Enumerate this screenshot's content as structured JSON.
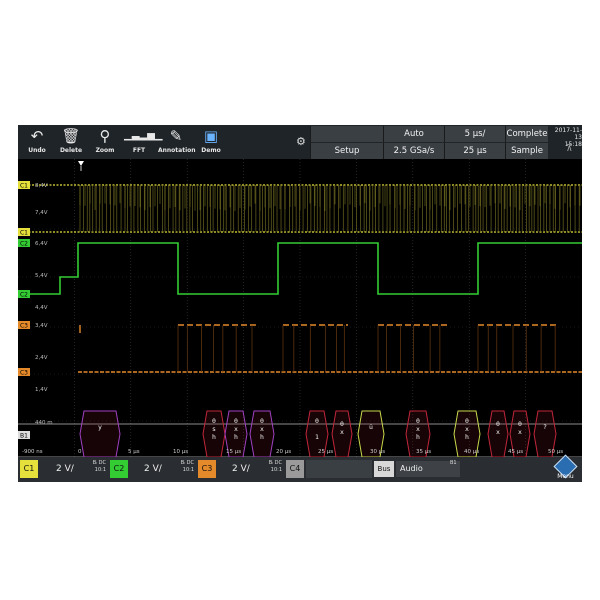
{
  "toolbar": {
    "buttons": [
      {
        "label": "Undo",
        "icon": "undo-arrow-icon"
      },
      {
        "label": "Delete",
        "icon": "trash-icon"
      },
      {
        "label": "Zoom",
        "icon": "magnifier-icon"
      },
      {
        "label": "FFT",
        "icon": "spectrum-icon"
      },
      {
        "label": "Annotation",
        "icon": "pencil-icon"
      },
      {
        "label": "Demo",
        "icon": "demo-monitor-icon"
      }
    ]
  },
  "header": {
    "trigger_source": "B1",
    "trigger_mode": "Auto",
    "time_scale": "5 µs/",
    "acq_state": "Complete",
    "setup": "Setup",
    "sample_rate": "2.5 GSa/s",
    "record_length": "25 µs",
    "acq_mode": "Sample",
    "date": "2017-11-13",
    "time": "15:18"
  },
  "channels": {
    "c1": {
      "tag": "C1",
      "color": "#e6e03c",
      "level_a": "8,4V",
      "level_b": "7,4V"
    },
    "c2": {
      "tag": "C2",
      "color": "#33cc33",
      "level_a": "6,4V",
      "level_b": "5,4V",
      "level_c": "4,4V"
    },
    "c3": {
      "tag": "C3",
      "color": "#e58a2a",
      "level_a": "3,4V",
      "level_b": "2,4V",
      "level_c": "1,4V"
    },
    "bus": {
      "tag": "B1",
      "level": "440 m"
    }
  },
  "time_axis": {
    "labels": [
      "-900 ns",
      "0",
      "5 µs",
      "10 µs",
      "15 µs",
      "20 µs",
      "25 µs",
      "30 µs",
      "35 µs",
      "40 µs",
      "45 µs",
      "50 µs"
    ]
  },
  "decode": [
    {
      "text": "y"
    },
    {
      "text": "0\ns\nh"
    },
    {
      "text": "0\nx\nh"
    },
    {
      "text": "0\nx\nh"
    },
    {
      "text": "0\n\n1"
    },
    {
      "text": "0\nx"
    },
    {
      "text": "ü"
    },
    {
      "text": "0\nx\nh"
    },
    {
      "text": "0\nx\nh"
    },
    {
      "text": "0\nx"
    },
    {
      "text": "0\nx"
    },
    {
      "text": "?"
    }
  ],
  "bottom": {
    "c1": {
      "tag": "C1",
      "scale": "2 V/",
      "coupling": "Bₗ DC",
      "probe": "10:1"
    },
    "c2": {
      "tag": "C2",
      "scale": "2 V/",
      "coupling": "Bₗ DC",
      "probe": "10:1"
    },
    "c3": {
      "tag": "C3",
      "scale": "2 V/",
      "coupling": "Bₗ DC",
      "probe": "10:1"
    },
    "c4": {
      "tag": "C4"
    },
    "bus_tag": "Bus",
    "bus_name": "Audio",
    "bus_id": "B1",
    "menu": "Menu"
  },
  "colors": {
    "c1": "#e6e03c",
    "c2": "#33cc33",
    "c3": "#e58a2a",
    "c4": "#9a9a9a",
    "decode_frame": "#c0263a",
    "decode_frame_alt": "#a040c0",
    "decode_frame_green": "#c8d84a"
  }
}
